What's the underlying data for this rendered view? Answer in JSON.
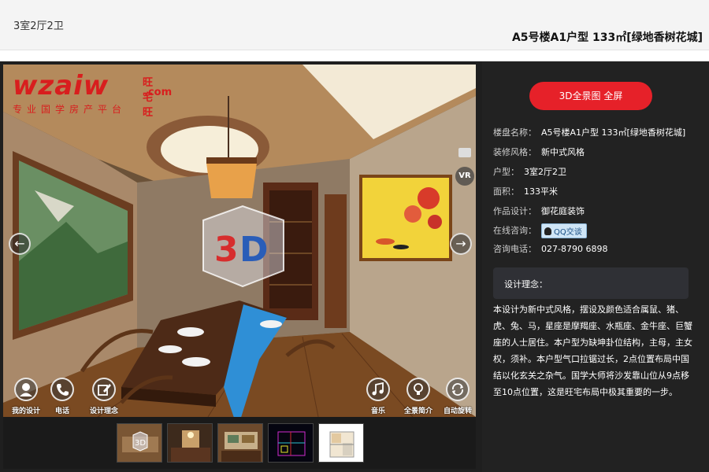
{
  "header": {
    "tag": "3室2厅2卫",
    "title": "A5号楼A1户型 133㎡[绿地香树花城]"
  },
  "brand": {
    "logo_text": "wzaiw",
    "logo_cn": "旺宅旺",
    "logo_com": ".com",
    "slogan": "专业国学房产平台"
  },
  "viewer": {
    "prev_icon": "arrow-left-icon",
    "next_icon": "arrow-right-icon",
    "vr_label": "VR",
    "controls_left": [
      {
        "label": "我的设计",
        "icon": "user-icon"
      },
      {
        "label": "电话",
        "icon": "phone-icon"
      },
      {
        "label": "设计理念",
        "icon": "edit-icon"
      }
    ],
    "controls_right": [
      {
        "label": "音乐",
        "icon": "music-icon"
      },
      {
        "label": "全景简介",
        "icon": "lightbulb-icon"
      },
      {
        "label": "自动旋转",
        "icon": "rotate-icon"
      }
    ],
    "thumbnails": [
      "dining-room-3d",
      "hallway",
      "living-room",
      "floor-plan-dark",
      "floor-plan-light"
    ]
  },
  "panel": {
    "fullscreen_button": "3D全景图 全屏",
    "rows": [
      {
        "key": "楼盘名称：",
        "value": "A5号楼A1户型 133㎡[绿地香树花城]"
      },
      {
        "key": "装修风格：",
        "value": "新中式风格"
      },
      {
        "key": "户型：",
        "value": "3室2厅2卫"
      },
      {
        "key": "面积：",
        "value": "133平米"
      },
      {
        "key": "作品设计：",
        "value": "御花庭装饰"
      },
      {
        "key": "在线咨询：",
        "value": ""
      },
      {
        "key": "咨询电话：",
        "value": "027-8790 6898"
      }
    ],
    "qq_label": "QQ交谈",
    "design_title": "设计理念：",
    "design_text": "本设计为新中式风格，摆设及颜色适合属鼠、猪、虎、兔、马，星座是摩羯座、水瓶座、金牛座、巨蟹座的人士居住。本户型为缺坤卦位结构，主母，主女权，须补。本户型气口拉锯过长，2点位置布局中国结以化玄关之杂气。国学大师将沙发靠山位从9点移至10点位置，这是旺宅布局中极其重要的一步。"
  },
  "colors": {
    "accent": "#e62129",
    "panel_bg": "#222222",
    "brand_red": "#d81e1e"
  }
}
